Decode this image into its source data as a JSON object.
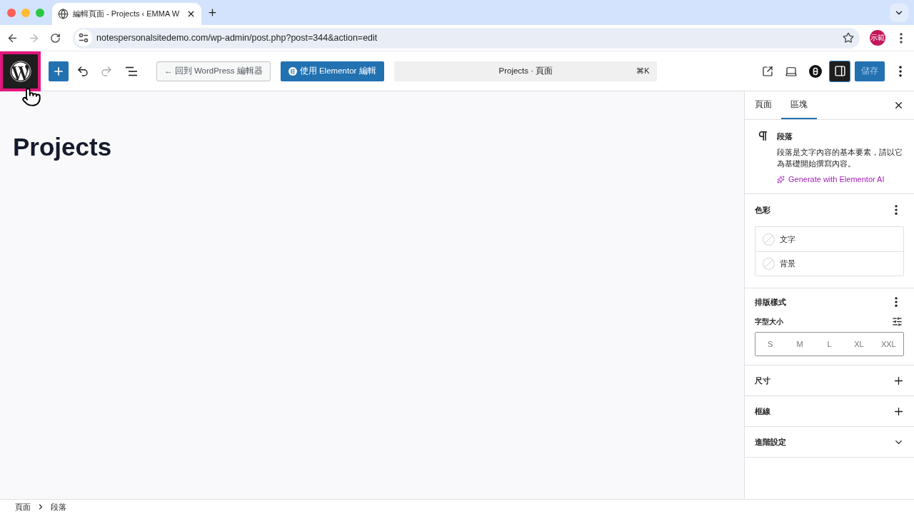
{
  "browser": {
    "tabs": [
      {
        "title": "編輯頁面 - Projects ‹ EMMA W",
        "selected": true
      }
    ],
    "url": "notespersonalsitedemo.com/wp-admin/post.php?post=344&action=edit",
    "forward_disabled": true,
    "profile": "示範"
  },
  "toolbar": {
    "logo_highlighted": true,
    "redo_disabled": true,
    "back_button": "← 回到 WordPress 編輯器",
    "elementor_button": "使用 Elementor 編輯",
    "command_title": "Projects · 頁面",
    "command_shortcut": "⌘K",
    "settings_pressed": true,
    "save_button": "儲存",
    "save_disabled": true
  },
  "canvas": {
    "title": "Projects"
  },
  "sidebar": {
    "tabs": [
      {
        "label": "頁面",
        "selected": false
      },
      {
        "label": "區塊",
        "selected": true
      }
    ],
    "block": {
      "name": "段落",
      "description": "段落是文字內容的基本要素，請以它為基礎開始撰寫內容。",
      "ai_link": "Generate with Elementor AI"
    },
    "panels": [
      {
        "kind": "colors",
        "title": "色彩",
        "items": [
          {
            "label": "文字"
          },
          {
            "label": "背景"
          }
        ]
      },
      {
        "kind": "typography",
        "title": "排版樣式",
        "field_label": "字型大小",
        "sizes": [
          "S",
          "M",
          "L",
          "XL",
          "XXL"
        ]
      },
      {
        "kind": "addable",
        "title": "尺寸"
      },
      {
        "kind": "addable",
        "title": "框線"
      },
      {
        "kind": "collapsible",
        "title": "進階設定",
        "expanded": false
      }
    ]
  },
  "breadcrumb": [
    "頁面",
    "段落"
  ]
}
